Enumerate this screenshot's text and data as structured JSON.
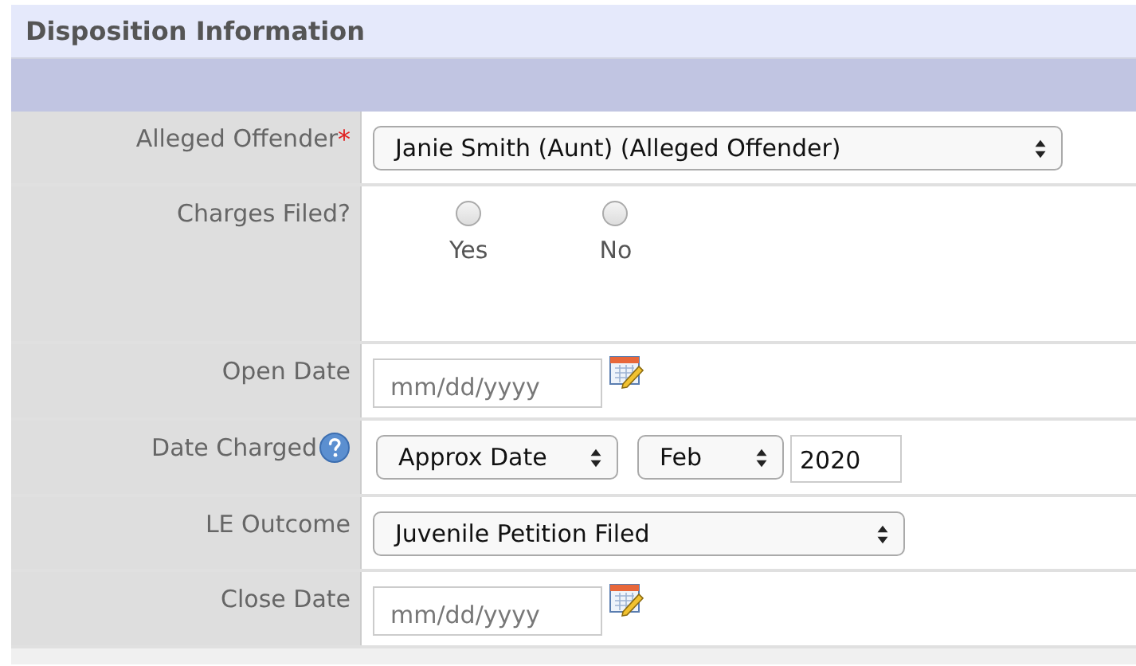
{
  "section": {
    "title": "Disposition Information"
  },
  "fields": [
    {
      "kind": "select",
      "label": "Alleged Offender",
      "required_mark": "*",
      "value": "Janie Smith (Aunt) (Alleged Offender)"
    },
    {
      "kind": "radio",
      "label": "Charges Filed?",
      "options": [
        {
          "label": "Yes",
          "selected": false
        },
        {
          "label": "No",
          "selected": false
        }
      ]
    },
    {
      "kind": "date",
      "label": "Open Date",
      "placeholder": "mm/dd/yyyy"
    },
    {
      "kind": "approx_date",
      "label": "Date Charged",
      "help": true,
      "precision": "Approx Date",
      "month": "Feb",
      "year": "2020"
    },
    {
      "kind": "select",
      "label": "LE Outcome",
      "value": "Juvenile Petition Filed"
    },
    {
      "kind": "date",
      "label": "Close Date",
      "placeholder": "mm/dd/yyyy"
    }
  ]
}
